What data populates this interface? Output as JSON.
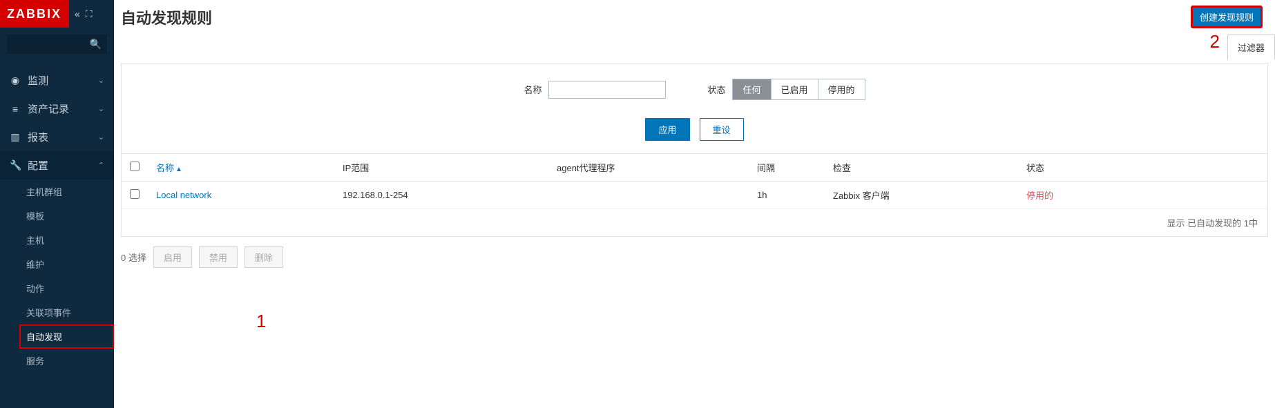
{
  "logo": "ZABBIX",
  "page_title": "自动发现规则",
  "create_button": "创建发现规则",
  "filter_tab": "过滤器",
  "nav": [
    {
      "icon": "◉",
      "label": "监测",
      "chev": "⌄"
    },
    {
      "icon": "≡",
      "label": "资产记录",
      "chev": "⌄"
    },
    {
      "icon": "▥",
      "label": "报表",
      "chev": "⌄"
    },
    {
      "icon": "🔧",
      "label": "配置",
      "chev": "⌃",
      "expanded": true
    }
  ],
  "sub_nav": [
    "主机群组",
    "模板",
    "主机",
    "维护",
    "动作",
    "关联项事件",
    "自动发现",
    "服务"
  ],
  "selected_sub_index": 6,
  "filter": {
    "name_label": "名称",
    "name_value": "",
    "status_label": "状态",
    "status_options": [
      "任何",
      "已启用",
      "停用的"
    ],
    "status_active_index": 0,
    "apply": "应用",
    "reset": "重设"
  },
  "columns": {
    "name": "名称",
    "ip_range": "IP范围",
    "agent_proxy": "agent代理程序",
    "interval": "间隔",
    "check": "检查",
    "status": "状态"
  },
  "rows": [
    {
      "name": "Local network",
      "ip_range": "192.168.0.1-254",
      "agent_proxy": "",
      "interval": "1h",
      "check": "Zabbix 客户端",
      "status": "停用的"
    }
  ],
  "footer_text": "显示 已自动发现的 1中",
  "bulk": {
    "selected_text": "0 选择",
    "enable": "启用",
    "disable": "禁用",
    "delete": "删除"
  },
  "annotations": {
    "one": "1",
    "two": "2"
  }
}
